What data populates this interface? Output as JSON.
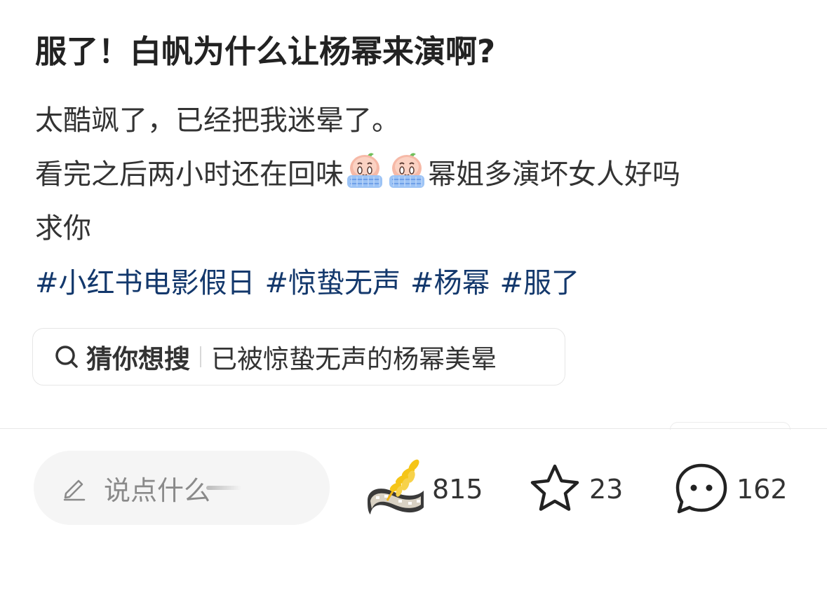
{
  "post": {
    "title": "服了！白帆为什么让杨幂来演啊?",
    "body_line1": "太酷飒了，已经把我迷晕了。",
    "body_line2_before": "看完之后两小时还在回味",
    "body_line2_after": "幂姐多演坏女人好吗",
    "body_line3": "求你",
    "emoji_name": "crying-face-emoji",
    "hashtags": [
      "#小红书电影假日",
      "#惊蛰无声",
      "#杨幂",
      "#服了"
    ]
  },
  "search_suggest": {
    "label": "猜你想搜",
    "query": "已被惊蛰无声的杨幂美晕"
  },
  "bottom_bar": {
    "comment_placeholder": "说点什么",
    "like_count": "815",
    "collect_count": "23",
    "comment_count": "162"
  },
  "colors": {
    "hashtag": "#13386c",
    "text": "#333333",
    "placeholder": "#8a8a8a",
    "input_bg": "#f5f5f5"
  }
}
